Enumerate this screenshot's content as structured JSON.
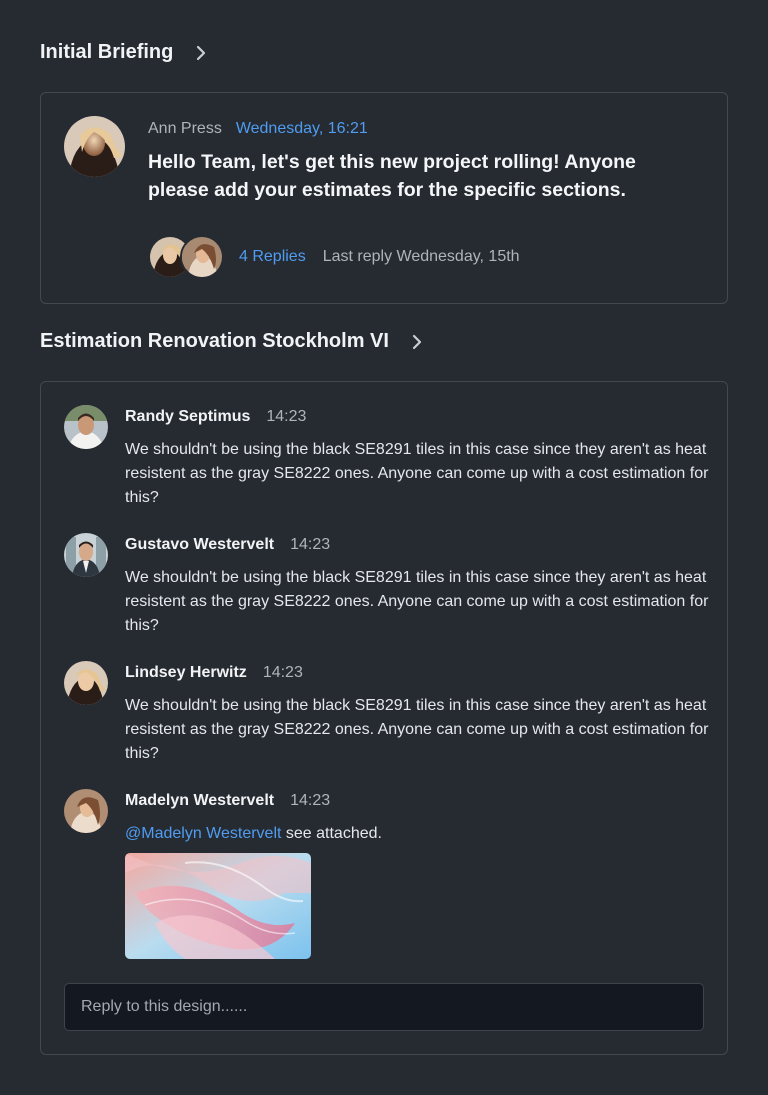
{
  "sections": [
    {
      "title": "Initial Briefing",
      "post": {
        "author": "Ann Press",
        "time": "Wednesday, 16:21",
        "text": "Hello Team, let's get this new project rolling! Anyone please add your estimates for the specific sections.",
        "replies_label": "4 Replies",
        "last_reply": "Last reply Wednesday, 15th"
      }
    },
    {
      "title": "Estimation Renovation Stockholm VI",
      "comments": [
        {
          "author": "Randy Septimus",
          "time": "14:23",
          "text": "We shouldn't be using the black SE8291 tiles in this case since they aren't as heat resistent as the gray SE8222 ones. Anyone can come up with a cost estimation for this?"
        },
        {
          "author": "Gustavo Westervelt",
          "time": "14:23",
          "text": "We shouldn't be using the black SE8291 tiles in this case since they aren't as heat resistent as the gray SE8222 ones. Anyone can come up with a cost estimation for this?"
        },
        {
          "author": "Lindsey Herwitz",
          "time": "14:23",
          "text": "We shouldn't be using the black SE8291 tiles in this case since they aren't as heat resistent as the gray SE8222 ones. Anyone can come up with a cost estimation for this?"
        },
        {
          "author": "Madelyn Westervelt",
          "time": "14:23",
          "mention": "@Madelyn Westervelt",
          "text": " see attached."
        }
      ],
      "reply_placeholder": "Reply to this design......"
    }
  ],
  "colors": {
    "background": "#262b32",
    "card_border": "#414852",
    "accent": "#4f9cf0",
    "input_background": "#141820"
  },
  "icons": {
    "section_chevron": "chevron-right-icon",
    "attachment": "image-attachment"
  }
}
